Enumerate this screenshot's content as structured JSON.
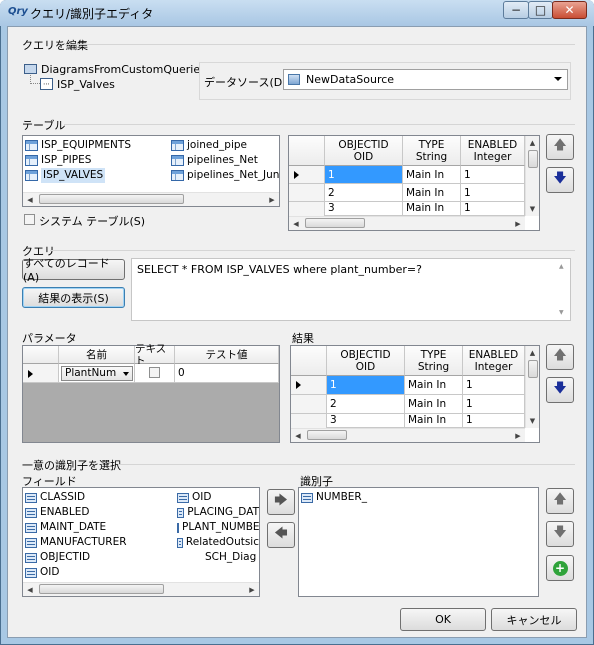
{
  "window": {
    "app_badge": "Qry",
    "title": "クエリ/識別子エディタ"
  },
  "edit_group": {
    "label": "クエリを編集",
    "tree_root": "DiagramsFromCustomQueries",
    "tree_child": "ISP_Valves",
    "datasource_label": "データソース(D):",
    "datasource_value": "NewDataSource"
  },
  "table_group": {
    "label": "テーブル",
    "tables": [
      "ISP_EQUIPMENTS",
      "ISP_PIPES",
      "ISP_VALVES",
      "joined_pipe",
      "pipelines_Net",
      "pipelines_Net_Jun"
    ],
    "system_table_label": "システム テーブル(S)"
  },
  "preview_grid": {
    "headers": [
      {
        "a": "OBJECTID",
        "b": "OID"
      },
      {
        "a": "TYPE",
        "b": "String"
      },
      {
        "a": "ENABLED",
        "b": "Integer"
      }
    ],
    "rows": [
      [
        "1",
        "Main In",
        "1"
      ],
      [
        "2",
        "Main In",
        "1"
      ],
      [
        "3",
        "Main In",
        "1"
      ]
    ]
  },
  "query_group": {
    "label": "クエリ",
    "all_records_button": "すべてのレコード(A)",
    "show_results_button": "結果の表示(S)",
    "sql": "SELECT * FROM ISP_VALVES where plant_number=?"
  },
  "params": {
    "label": "パラメータ",
    "headers": [
      "名前",
      "テキスト",
      "テスト値"
    ],
    "row": {
      "name": "PlantNum",
      "test_value": "0"
    }
  },
  "results": {
    "label": "結果",
    "headers": [
      {
        "a": "OBJECTID",
        "b": "OID"
      },
      {
        "a": "TYPE",
        "b": "String"
      },
      {
        "a": "ENABLED",
        "b": "Integer"
      }
    ],
    "rows": [
      [
        "1",
        "Main In",
        "1"
      ],
      [
        "2",
        "Main In",
        "1"
      ],
      [
        "3",
        "Main In",
        "1"
      ]
    ]
  },
  "unique_id": {
    "label": "一意の識別子を選択",
    "fields_label": "フィールド",
    "fields_col1": [
      "CLASSID",
      "ENABLED",
      "MAINT_DATE",
      "MANUFACTURER",
      "OBJECTID",
      "OID"
    ],
    "fields_col2": [
      "OID",
      "PLACING_DAT",
      "PLANT_NUMBE",
      "RelatedOutsic",
      "SCH_Diag"
    ],
    "identifier_label": "識別子",
    "identifiers": [
      "NUMBER_"
    ]
  },
  "footer": {
    "ok": "OK",
    "cancel": "キャンセル"
  }
}
